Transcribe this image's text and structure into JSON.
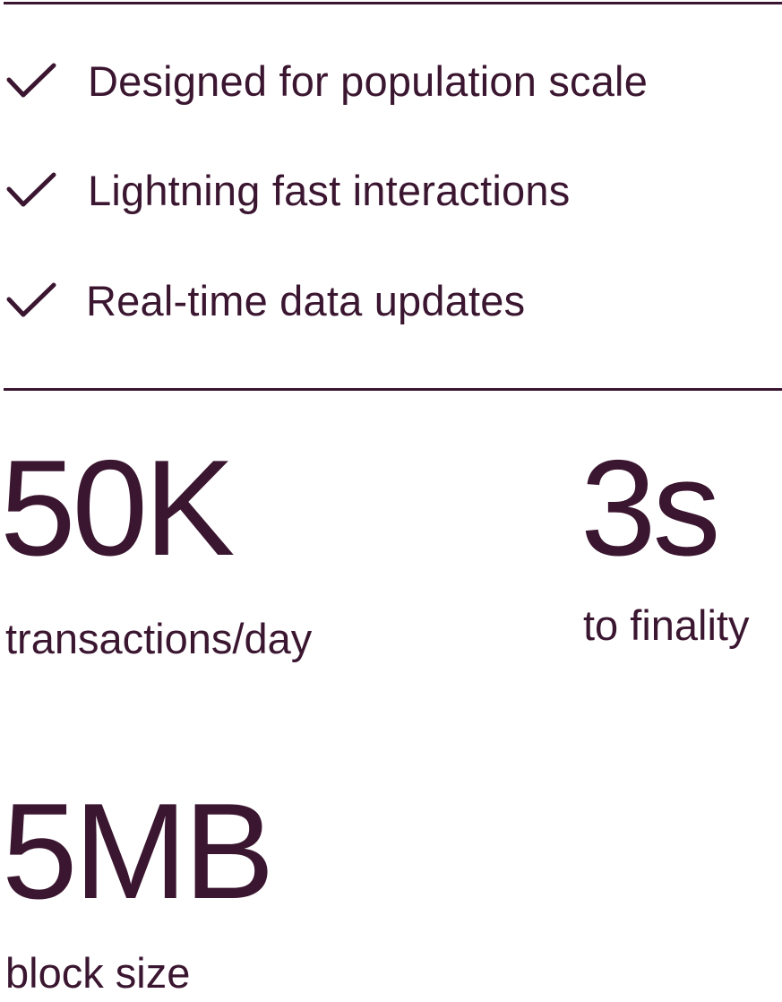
{
  "features": [
    {
      "label": "Designed for population scale",
      "icon": "check-icon"
    },
    {
      "label": "Lightning fast interactions",
      "icon": "check-icon"
    },
    {
      "label": "Real-time data updates",
      "icon": "check-icon"
    }
  ],
  "stats": [
    {
      "value": "50K",
      "label": "transactions/day"
    },
    {
      "value": "3s",
      "label": "to finality"
    },
    {
      "value": "5MB",
      "label": "block size"
    }
  ],
  "colors": {
    "text": "#3b1630",
    "background": "#ffffff"
  }
}
